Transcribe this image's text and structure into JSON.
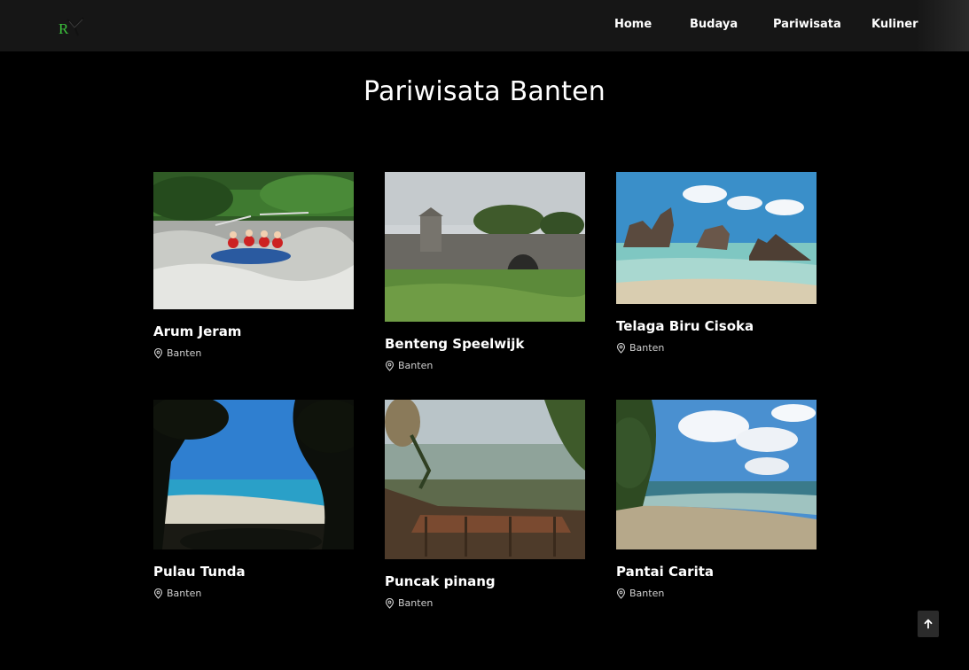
{
  "nav": {
    "items": [
      {
        "label": "Home"
      },
      {
        "label": "Budaya"
      },
      {
        "label": "Pariwisata"
      },
      {
        "label": "Kuliner"
      }
    ]
  },
  "page": {
    "title": "Pariwisata Banten"
  },
  "cards": [
    {
      "title": "Arum Jeram",
      "location": "Banten"
    },
    {
      "title": "Benteng Speelwijk",
      "location": "Banten"
    },
    {
      "title": "Telaga Biru Cisoka",
      "location": "Banten"
    },
    {
      "title": "Pulau Tunda",
      "location": "Banten"
    },
    {
      "title": "Puncak pinang",
      "location": "Banten"
    },
    {
      "title": "Pantai Carita",
      "location": "Banten"
    }
  ],
  "icons": {
    "logo": "logo-icon",
    "location": "map-pin-icon",
    "back_to_top": "arrow-up-icon"
  },
  "colors": {
    "background": "#000000",
    "navbar": "#161616",
    "logo_green": "#3cc13c"
  }
}
